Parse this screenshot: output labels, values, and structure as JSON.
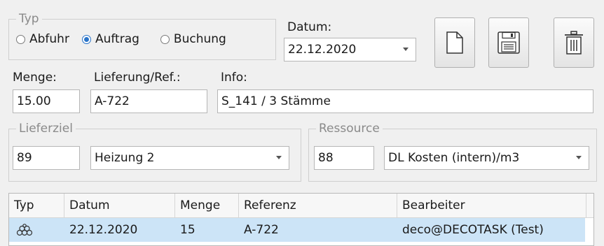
{
  "typ_group": {
    "legend": "Typ",
    "options": [
      {
        "label": "Abfuhr",
        "checked": false
      },
      {
        "label": "Auftrag",
        "checked": true
      },
      {
        "label": "Buchung",
        "checked": false
      }
    ]
  },
  "datum": {
    "label": "Datum:",
    "value": "22.12.2020"
  },
  "toolbar": {
    "new_icon": "new-document-icon",
    "save_icon": "floppy-disk-icon",
    "delete_icon": "trash-icon"
  },
  "menge": {
    "label": "Menge:",
    "value": "15.00"
  },
  "lieferung": {
    "label": "Lieferung/Ref.:",
    "value": "A-722"
  },
  "info": {
    "label": "Info:",
    "value": "S_141 / 3 Stämme"
  },
  "lieferziel": {
    "legend": "Lieferziel",
    "code": "89",
    "name": "Heizung 2"
  },
  "ressource": {
    "legend": "Ressource",
    "code": "88",
    "name": "DL Kosten (intern)/m3"
  },
  "grid": {
    "columns": [
      "Typ",
      "Datum",
      "Menge",
      "Referenz",
      "Bearbeiter"
    ],
    "rows": [
      {
        "typ_icon": "log-pile-icon",
        "datum": "22.12.2020",
        "menge": "15",
        "referenz": "A-722",
        "bearbeiter": "deco@DECOTASK (Test)"
      }
    ]
  },
  "colors": {
    "selection": "#cce4f7",
    "accent": "#2a74c9"
  }
}
